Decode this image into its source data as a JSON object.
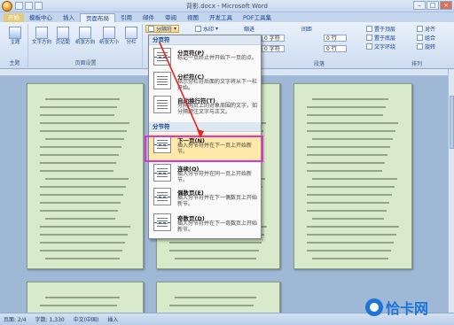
{
  "title_bar": {
    "title": "背影.docx - Microsoft Word",
    "minimize": "–",
    "maximize": "□",
    "close": "×"
  },
  "tabs": [
    {
      "label": "开始"
    },
    {
      "label": "模板中心"
    },
    {
      "label": "插入"
    },
    {
      "label": "页面布局"
    },
    {
      "label": "引用"
    },
    {
      "label": "邮件"
    },
    {
      "label": "审阅"
    },
    {
      "label": "视图"
    },
    {
      "label": "开发工具"
    },
    {
      "label": "PDF工具集"
    }
  ],
  "ribbon": {
    "theme_group": {
      "label": "主题",
      "buttons": [
        "主题"
      ]
    },
    "page_setup_group": {
      "label": "页面设置",
      "buttons": [
        "文字方向",
        "页边距",
        "纸张方向",
        "纸张大小",
        "分栏"
      ]
    },
    "breaks_button": "分隔符",
    "watermark_button": "水印",
    "indent_label": "缩进",
    "spacing_label": "间距",
    "paragraph_label": "段落",
    "arrange_label": "排列",
    "indent_left": "0 字符",
    "indent_right": "0 字符",
    "spacing_before": "0 行",
    "spacing_after": "0 行",
    "position": "位置",
    "bring_front": "置于顶层",
    "send_back": "置于底层",
    "wrap_text": "文字环绕",
    "align": "对齐",
    "group": "组合",
    "rotate": "旋转"
  },
  "breaks_menu": {
    "section_page_header": "分页符",
    "section_section_header": "分节符",
    "items": [
      {
        "title": "分页符(P)",
        "desc": "标记一页终止并开始下一页的点。"
      },
      {
        "title": "分栏符(C)",
        "desc": "指示分栏符后面的文字将从下一栏开始。"
      },
      {
        "title": "自动换行符(T)",
        "desc": "分隔网页上的对象周围的文字，如分隔题注文字与正文。"
      },
      {
        "title": "下一页(N)",
        "desc": "插入分节符并在下一页上开始新节。"
      },
      {
        "title": "连续(O)",
        "desc": "插入分节符并在同一页上开始新节。"
      },
      {
        "title": "偶数页(E)",
        "desc": "插入分节符并在下一偶数页上开始新节。"
      },
      {
        "title": "奇数页(D)",
        "desc": "插入分节符并在下一奇数页上开始新节。"
      }
    ]
  },
  "status_bar": {
    "page": "页面: 2/4",
    "words": "字数: 1,330",
    "language": "中文(中国)",
    "mode": "插入"
  },
  "watermark": {
    "text": "恰卡网"
  }
}
